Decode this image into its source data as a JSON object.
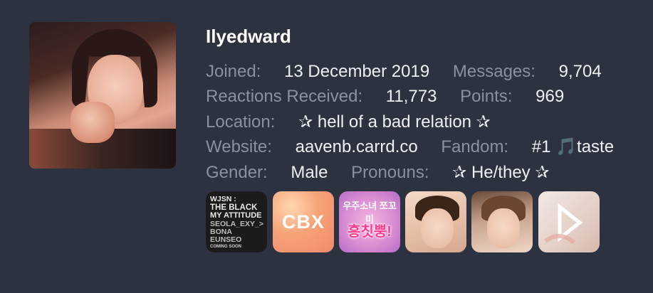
{
  "profile": {
    "username": "Ilyedward",
    "avatar_icon": "profile-photo-icon"
  },
  "stats": {
    "joined_label": "Joined:",
    "joined_value": "13 December 2019",
    "messages_label": "Messages:",
    "messages_value": "9,704",
    "reactions_label": "Reactions Received:",
    "reactions_value": "11,773",
    "points_label": "Points:",
    "points_value": "969",
    "location_label": "Location:",
    "location_value": "✰ hell of a bad relation ✰",
    "website_label": "Website:",
    "website_value": "aavenb.carrd.co",
    "fandom_label": "Fandom:",
    "fandom_value": "#1 🎵taste",
    "gender_label": "Gender:",
    "gender_value": "Male",
    "pronouns_label": "Pronouns:",
    "pronouns_value": "✰ He/they ✰"
  },
  "badges": {
    "b1_lines": [
      "WJSN :",
      "THE BLACK",
      "MY ATTITUDE",
      "SEOLA_EXY_>",
      "BONA",
      "EUNSEO",
      "COMING SOON"
    ],
    "b2_text": "CBX",
    "b3_top": "우주소녀 쪼꼬미",
    "b3_main": "흥칫뿡!"
  },
  "colors": {
    "background": "#2d3240",
    "label": "#8b90a0",
    "value": "#eef0f4",
    "username": "#ffffff"
  }
}
